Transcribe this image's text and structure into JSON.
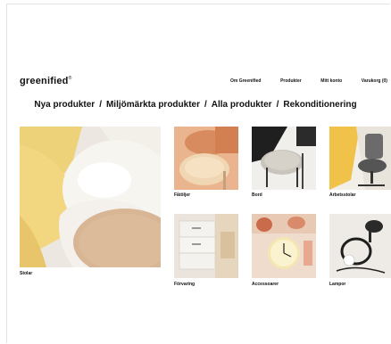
{
  "brand": {
    "logo": "greenified",
    "trademark": "®"
  },
  "topnav": {
    "items": [
      "Om Greenified",
      "Produkter",
      "Mitt konto",
      "Varukorg (0)"
    ]
  },
  "categories": {
    "items": [
      "Nya produkter",
      "Miljömärkta produkter",
      "Alla produkter",
      "Rekonditionering"
    ],
    "separator": "/"
  },
  "tiles": {
    "main": {
      "label": "Stolar"
    },
    "small": [
      {
        "label": "Fåtöljer"
      },
      {
        "label": "Bord"
      },
      {
        "label": "Arbetsstolar"
      },
      {
        "label": "Förvaring"
      },
      {
        "label": "Accessoarer"
      },
      {
        "label": "Lampor"
      }
    ]
  }
}
